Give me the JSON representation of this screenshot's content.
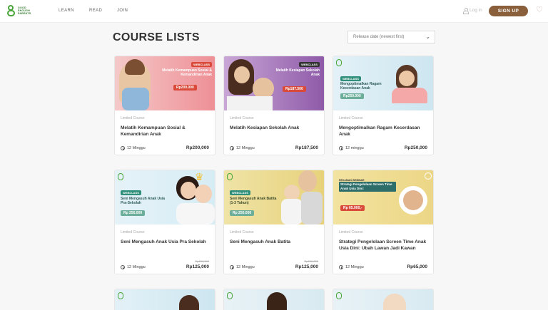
{
  "nav": {
    "logo_text": [
      "GOOD",
      "ENOUGH",
      "PARENTS"
    ],
    "links": [
      "LEARN",
      "READ",
      "JOIN"
    ],
    "login": "Log in",
    "signup": "SIGN UP"
  },
  "page": {
    "title": "COURSE LISTS",
    "sort_value": "Release date (newest first)"
  },
  "colors": {
    "brand_green": "#49a53a",
    "signup_brown": "#8a5f3c",
    "price_red": "#d94a3a",
    "webclass_teal": "#2f8f7a"
  },
  "courses": [
    {
      "type": "Limited Course",
      "title": "Melatih Kemampuan Sosial & Kemandirian Anak",
      "duration": "12 Minggu",
      "price": "Rp200,000",
      "banner": {
        "webclass": "WEBCLASS",
        "title": "Melatih Kemampuan Sosial & Kemandirian Anak",
        "price": "Rp200.000"
      }
    },
    {
      "type": "Limited Course",
      "title": "Melatih Kesiapan Sekolah Anak",
      "duration": "12 Minggu",
      "price": "Rp187,500",
      "banner": {
        "webclass": "WEBCLASS",
        "title": "Melatih Kesiapan Sekolah Anak",
        "price": "Rp187.500"
      }
    },
    {
      "type": "Limited Course",
      "title": "Mengoptimalkan Ragam Kecerdasan Anak",
      "duration": "12 minggu",
      "price": "Rp250,000",
      "banner": {
        "webclass": "WEBCLASS",
        "title": "Mengoptimalkan Ragam Kecerdasan Anak",
        "price": "Rp250.000"
      }
    },
    {
      "type": "Limited Course",
      "title": "Seni Mengasuh Anak Usia Pra Sekolah",
      "duration": "12 Minggu",
      "price": "Rp125,000",
      "old_price": "Rp250,000",
      "banner": {
        "webclass": "WEBCLASS",
        "title": "Seni Mengasuh Anak Usia Pra-Sekolah",
        "price": "Rp 250.000"
      }
    },
    {
      "type": "Limited Course",
      "title": "Seni Mengasuh Anak Batita",
      "duration": "12 Minggu",
      "price": "Rp125,000",
      "old_price": "Rp250,000",
      "banner": {
        "webclass": "WEBCLASS",
        "title": "Seni Mengasuh Anak Batita (1-3 Tahun)",
        "price": "Rp 250.000"
      }
    },
    {
      "type": "Limited Course",
      "title": "Strategi Pengelolaan Screen Time Anak Usia Dini: Ubah Lawan Jadi Kawan",
      "duration": "12 Minggu",
      "price": "Rp65,000",
      "banner": {
        "webclass": "REKAMAN WEBINAR",
        "title": "Strategi Pengelolaan Screen Time Anak Usia Dini:",
        "price": "Rp 65.000,-"
      }
    }
  ]
}
